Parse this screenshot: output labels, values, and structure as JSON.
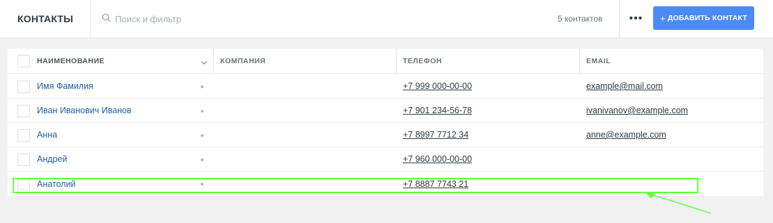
{
  "header": {
    "title": "КОНТАКТЫ",
    "search_placeholder": "Поиск и фильтр",
    "count_text": "5 контактов",
    "more_label": "•••",
    "add_button_label": "ДОБАВИТЬ КОНТАКТ"
  },
  "table": {
    "columns": [
      "НАИМЕНОВАНИЕ",
      "КОМПАНИЯ",
      "ТЕЛЕФОН",
      "EMAIL"
    ],
    "rows": [
      {
        "name": "Имя Фамилия",
        "company": "",
        "phone": "+7 999 000-00-00",
        "email": "example@mail.com"
      },
      {
        "name": "Иван Иванович Иванов",
        "company": "",
        "phone": "+7 901 234-56-78",
        "email": "ivanivanov@example.com"
      },
      {
        "name": "Анна",
        "company": "",
        "phone": "+7 8997 7712 34",
        "email": "anne@example.com"
      },
      {
        "name": "Андрей",
        "company": "",
        "phone": "+7 960 000-00-00",
        "email": ""
      },
      {
        "name": "Анатолий",
        "company": "",
        "phone": "+7 8887 7743 21",
        "email": ""
      }
    ]
  },
  "colors": {
    "accent": "#4c8bf5",
    "name_link": "#1f5fa6",
    "highlight": "#66ff44"
  },
  "icons": [
    "search-icon",
    "chevron-down-icon",
    "plus-icon",
    "arrow-annotation"
  ]
}
